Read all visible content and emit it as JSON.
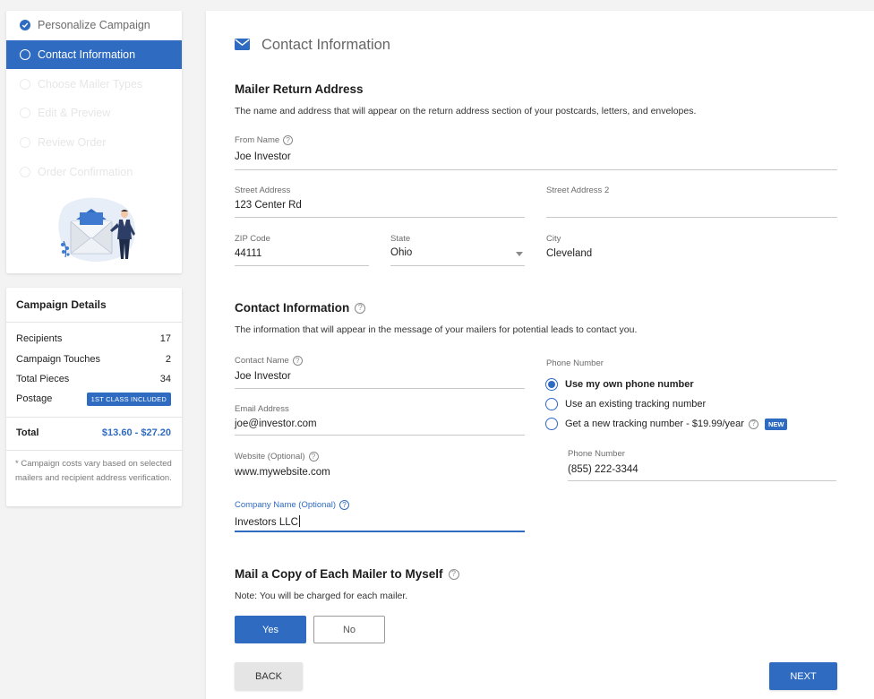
{
  "steps": [
    {
      "label": "Personalize Campaign",
      "state": "done"
    },
    {
      "label": "Contact Information",
      "state": "active"
    },
    {
      "label": "Choose Mailer Types",
      "state": "pending"
    },
    {
      "label": "Edit & Preview",
      "state": "pending"
    },
    {
      "label": "Review Order",
      "state": "pending"
    },
    {
      "label": "Order Confirmation",
      "state": "pending"
    }
  ],
  "campaign_details": {
    "title": "Campaign Details",
    "recipients_label": "Recipients",
    "recipients_value": "17",
    "touches_label": "Campaign Touches",
    "touches_value": "2",
    "pieces_label": "Total Pieces",
    "pieces_value": "34",
    "postage_label": "Postage",
    "postage_badge": "1ST CLASS INCLUDED",
    "total_label": "Total",
    "total_value": "$13.60 - $27.20",
    "note": "* Campaign costs vary based on selected mailers and recipient address verification."
  },
  "page": {
    "title": "Contact Information",
    "icon": "envelope-icon"
  },
  "return_address": {
    "heading": "Mailer Return Address",
    "description": "The name and address that will appear on the return address section of your postcards, letters, and envelopes.",
    "from_name_label": "From Name",
    "from_name_value": "Joe Investor",
    "street_label": "Street Address",
    "street_value": "123 Center Rd",
    "street2_label": "Street Address 2",
    "street2_value": "",
    "zip_label": "ZIP Code",
    "zip_value": "44111",
    "state_label": "State",
    "state_value": "Ohio",
    "city_label": "City",
    "city_value": "Cleveland"
  },
  "contact_info": {
    "heading": "Contact Information",
    "description": "The information that will appear in the message of your mailers for potential leads to contact you.",
    "contact_name_label": "Contact Name",
    "contact_name_value": "Joe Investor",
    "email_label": "Email Address",
    "email_value": "joe@investor.com",
    "website_label": "Website (Optional)",
    "website_value": "www.mywebsite.com",
    "company_label": "Company Name (Optional)",
    "company_value": "Investors LLC",
    "phone_group_label": "Phone Number",
    "phone_options": [
      {
        "label": "Use my own phone number",
        "selected": true
      },
      {
        "label": "Use an existing tracking number",
        "selected": false
      },
      {
        "label": "Get a new tracking number - $19.99/year",
        "selected": false,
        "badge": "NEW"
      }
    ],
    "phone_label": "Phone Number",
    "phone_value": "(855) 222-3344"
  },
  "mail_copy": {
    "heading": "Mail a Copy of Each Mailer to Myself",
    "note": "Note: You will be charged for each mailer.",
    "yes_label": "Yes",
    "no_label": "No",
    "selected": "Yes"
  },
  "nav": {
    "back_label": "BACK",
    "next_label": "NEXT"
  },
  "colors": {
    "accent": "#2f6bc1",
    "background": "#f3f3f3"
  }
}
